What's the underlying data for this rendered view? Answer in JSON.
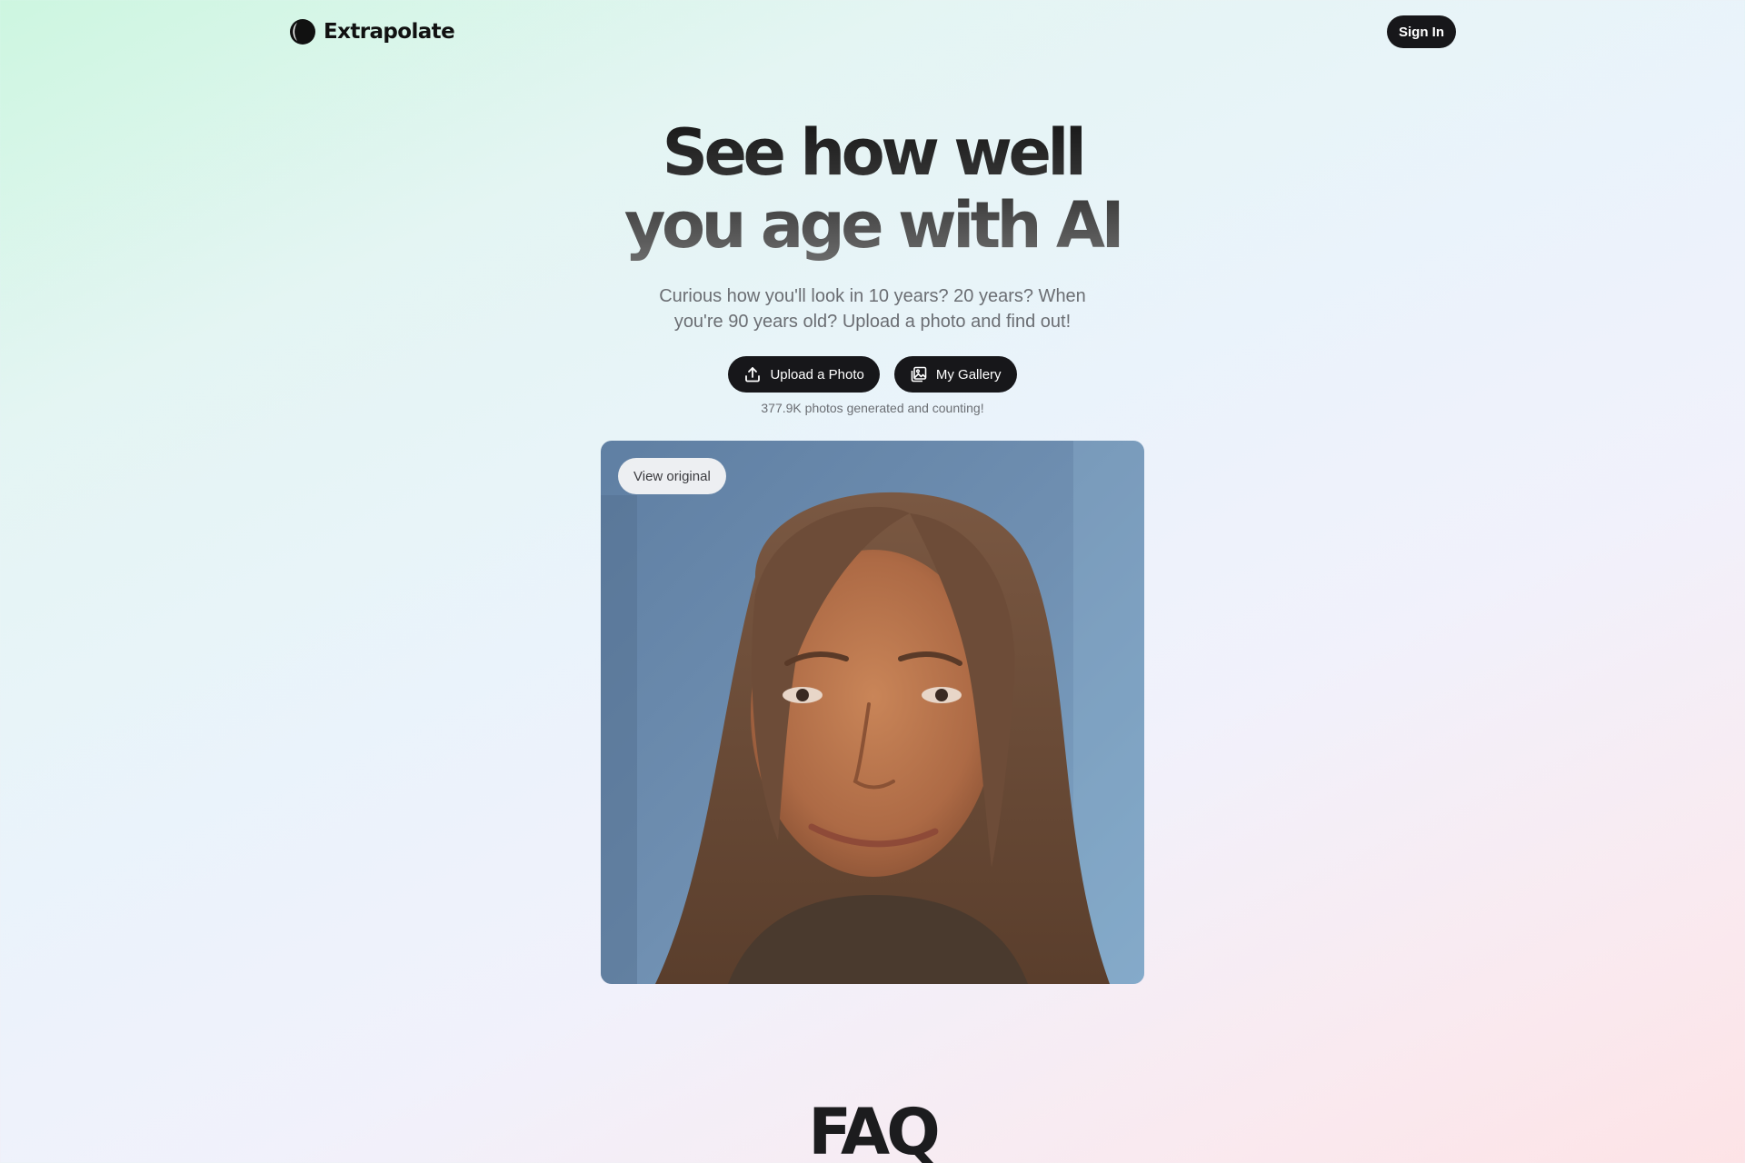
{
  "header": {
    "brand": "Extrapolate",
    "logo_icon": "extrapolate-logo-icon",
    "signin_label": "Sign In"
  },
  "hero": {
    "title_line1": "See how well",
    "title_line2": "you age with AI",
    "subtitle": "Curious how you'll look in 10 years? 20 years? When you're 90 years old? Upload a photo and find out!"
  },
  "actions": {
    "upload_label": "Upload a Photo",
    "upload_icon": "upload-icon",
    "gallery_label": "My Gallery",
    "gallery_icon": "gallery-icon"
  },
  "counter_text": "377.9K photos generated and counting!",
  "photo": {
    "view_original_label": "View original"
  },
  "faq": {
    "title": "FAQ"
  },
  "colors": {
    "button_bg": "#17171a",
    "subtitle_text": "#6b6e73",
    "gradient_start": "#cdf6e0",
    "gradient_end": "#fde3e6"
  }
}
